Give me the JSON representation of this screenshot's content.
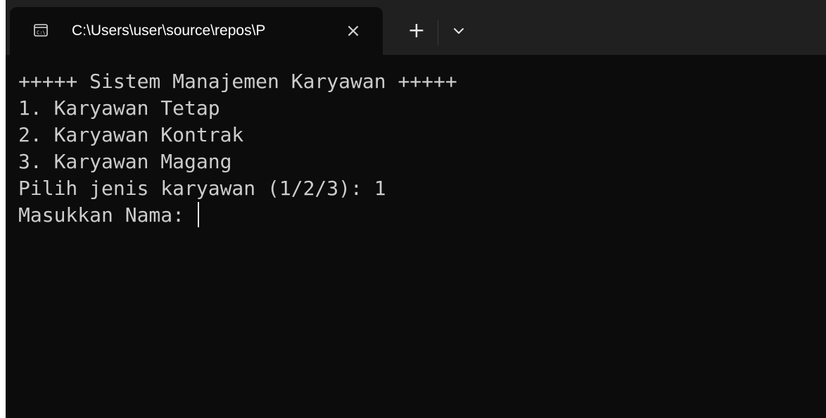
{
  "tab": {
    "title": "C:\\Users\\user\\source\\repos\\P",
    "icon": "terminal-icon",
    "close_glyph": "×"
  },
  "tabbar": {
    "new_tab_glyph": "+",
    "dropdown_icon": "chevron-down-icon"
  },
  "terminal": {
    "lines": [
      "+++++ Sistem Manajemen Karyawan +++++",
      "1. Karyawan Tetap",
      "2. Karyawan Kontrak",
      "3. Karyawan Magang",
      "Pilih jenis karyawan (1/2/3): 1",
      "Masukkan Nama: "
    ],
    "text_color": "#cccccc",
    "background": "#0c0c0c"
  }
}
